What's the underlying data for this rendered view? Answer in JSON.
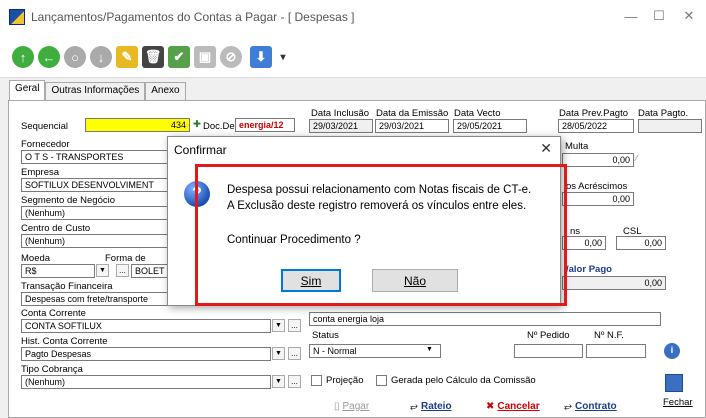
{
  "window": {
    "title": "Lançamentos/Pagamentos do Contas a Pagar  -  [ Despesas ]"
  },
  "tabs": [
    "Geral",
    "Outras Informações",
    "Anexo"
  ],
  "form": {
    "sequencial_label": "Sequencial",
    "sequencial_value": "434",
    "doc_despesa_label": "Doc.Despesa",
    "doc_despesa_value": "energia/12",
    "data_inclusao_label": "Data Inclusão",
    "data_inclusao_value": "29/03/2021",
    "data_emissao_label": "Data da Emissão",
    "data_emissao_value": "29/03/2021",
    "data_vecto_label": "Data Vecto",
    "data_vecto_value": "29/05/2021",
    "data_prev_pagto_label": "Data Prev.Pagto",
    "data_prev_pagto_value": "28/05/2022",
    "data_pagto_label": "Data Pagto.",
    "fornecedor_label": "Fornecedor",
    "fornecedor_value": "O T S - TRANSPORTES",
    "empresa_label": "Empresa",
    "empresa_value": "SOFTILUX DESENVOLVIMENT",
    "segmento_label": "Segmento de Negócio",
    "segmento_value": "(Nenhum)",
    "centro_custo_label": "Centro de Custo",
    "centro_custo_value": "(Nenhum)",
    "moeda_label": "Moeda",
    "moeda_value": "R$",
    "forma_label": "Forma de",
    "forma_value": "BOLET",
    "transacao_label": "Transação Financeira",
    "transacao_value": "Despesas com frete/transporte",
    "conta_corrente_label": "Conta Corrente",
    "conta_corrente_value": "CONTA SOFTILUX",
    "hist_conta_label": "Hist. Conta Corrente",
    "hist_conta_value": "Pagto Despesas",
    "tipo_cobranca_label": "Tipo Cobrança",
    "tipo_cobranca_value": "(Nenhum)",
    "multa_label": "Multa",
    "multa_value": "0,00",
    "acrescimos_label": "os Acréscimos",
    "acrescimos_value": "0,00",
    "ins_label": "ns",
    "ins_value": "0,00",
    "csl_label": "CSL",
    "csl_value": "0,00",
    "valor_pago_label": "/alor Pago",
    "valor_pago_value": "0,00",
    "observacao_value": "conta energia loja",
    "status_label": "Status",
    "status_value": "N - Normal",
    "pedido_label": "Nº Pedido",
    "nf_label": "Nº N.F.",
    "projecao_label": "Projeção",
    "comissao_label": "Gerada pelo Cálculo da Comissão"
  },
  "bottom_buttons": {
    "pagar": "Pagar",
    "rateio": "Rateio",
    "cancelar": "Cancelar",
    "contrato": "Contrato",
    "fechar": "Fechar"
  },
  "dialog": {
    "title": "Confirmar",
    "line1": "Despesa possui relacionamento com Notas fiscais de CT-e.",
    "line2": "A Exclusão deste registro removerá os vínculos entre eles.",
    "question": "Continuar Procedimento ?",
    "yes": "Sim",
    "no": "Não"
  },
  "colors": {
    "highlight_field": "#ffff00",
    "red_box": "#e0191d",
    "valor_pago": "#1a3c8c"
  }
}
